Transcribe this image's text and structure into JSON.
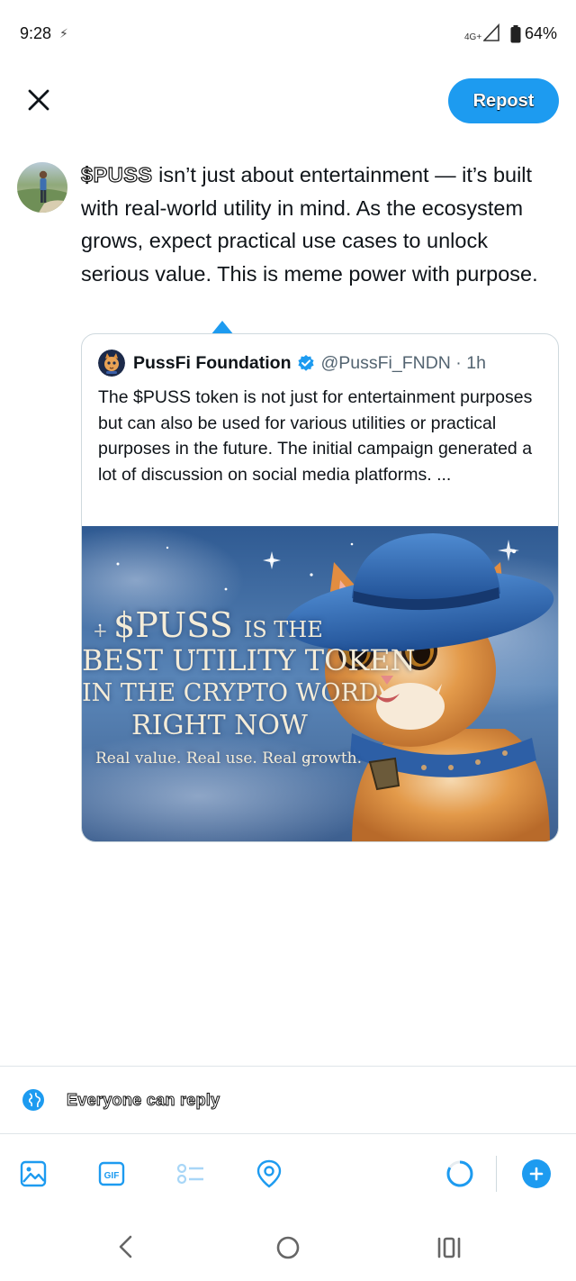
{
  "status_bar": {
    "time": "9:28",
    "network": "4G+",
    "battery": "64%"
  },
  "header": {
    "repost_label": "Repost"
  },
  "compose": {
    "cashtag": "$PUSS",
    "text": " isn’t just about entertainment — it’s built with real-world utility in mind. As the ecosystem grows, expect practical use cases to unlock serious value. This is meme power with purpose."
  },
  "quote": {
    "name": "PussFi Foundation",
    "handle": "@PussFi_FNDN · 1h",
    "text": "The $PUSS token is not just for entertainment purposes but can also be used for various utilities or practical purposes in the future. The initial campaign generated a lot of discussion on social media platforms. ...",
    "image_lines": {
      "line1_big": "$PUSS",
      "line1_small": "IS THE",
      "line2": "BEST UTILITY TOKEN",
      "line3": "IN THE CRYPTO WORD",
      "line4": "RIGHT NOW",
      "line5": "Real value. Real use. Real growth."
    }
  },
  "reply_setting": {
    "label": "Everyone can reply"
  },
  "toolbar": {
    "icons": [
      "image-icon",
      "gif-icon",
      "poll-icon",
      "location-icon",
      "char-counter-icon",
      "add-icon"
    ],
    "gif_label": "GIF"
  },
  "colors": {
    "accent": "#1d9bf0",
    "text": "#0f1419",
    "muted": "#536471",
    "border": "#cfd9de"
  }
}
